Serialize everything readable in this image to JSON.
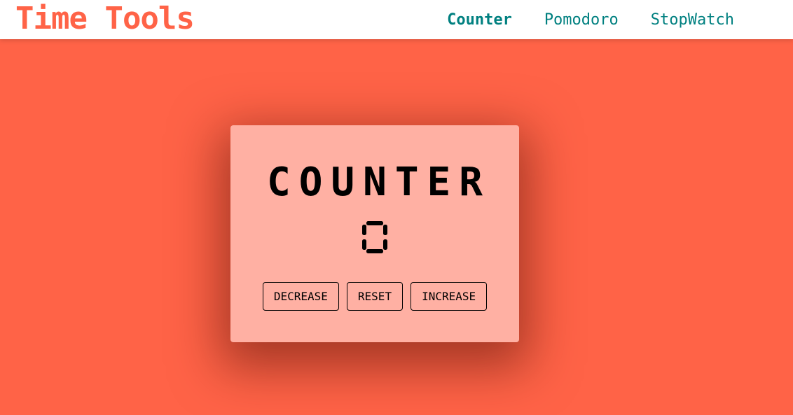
{
  "navbar": {
    "brand": "Time Tools",
    "links": [
      {
        "label": "Counter",
        "active": true
      },
      {
        "label": "Pomodoro",
        "active": false
      },
      {
        "label": "StopWatch",
        "active": false
      }
    ]
  },
  "counter": {
    "title": "COUNTER",
    "value": "0",
    "buttons": {
      "decrease": "DECREASE",
      "reset": "RESET",
      "increase": "INCREASE"
    }
  },
  "colors": {
    "brand": "#ff6347",
    "nav_link": "#008080",
    "background": "#ff6347",
    "card": "#ffb0a3"
  }
}
